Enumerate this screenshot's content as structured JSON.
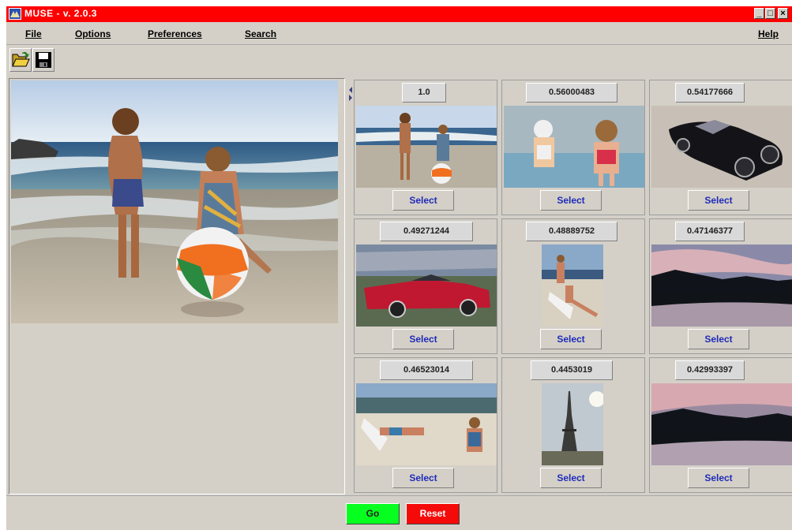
{
  "window": {
    "title": "MUSE - v. 2.0.3",
    "controls": {
      "minimize": "_",
      "maximize": "□",
      "close": "×"
    }
  },
  "menu": {
    "file": "File",
    "options": "Options",
    "preferences": "Preferences",
    "search": "Search",
    "help": "Help"
  },
  "toolbar": {
    "icons": [
      "open-folder-icon",
      "save-disk-icon"
    ]
  },
  "results": [
    {
      "score": "1.0",
      "select_label": "Select",
      "image": "two girls on beach with ball"
    },
    {
      "score": "0.56000483",
      "select_label": "Select",
      "image": "two children by pool"
    },
    {
      "score": "0.54177666",
      "select_label": "Select",
      "image": "black vintage car"
    },
    {
      "score": "0.49271244",
      "select_label": "Select",
      "image": "red convertible car"
    },
    {
      "score": "0.48889752",
      "select_label": "Select",
      "image": "girls on beach chair"
    },
    {
      "score": "0.47146377",
      "select_label": "Select",
      "image": "lake at dusk"
    },
    {
      "score": "0.46523014",
      "select_label": "Select",
      "image": "girls sunbathing on beach"
    },
    {
      "score": "0.4453019",
      "select_label": "Select",
      "image": "eiffel tower"
    },
    {
      "score": "0.42993397",
      "select_label": "Select",
      "image": "lake at sunset"
    }
  ],
  "actions": {
    "go_label": "Go",
    "reset_label": "Reset"
  },
  "colors": {
    "titlebar": "#fe0000",
    "window_bg": "#d4d0c8",
    "go": "#07ff20",
    "reset": "#f50a0a",
    "select_text": "#1f2bb8"
  }
}
